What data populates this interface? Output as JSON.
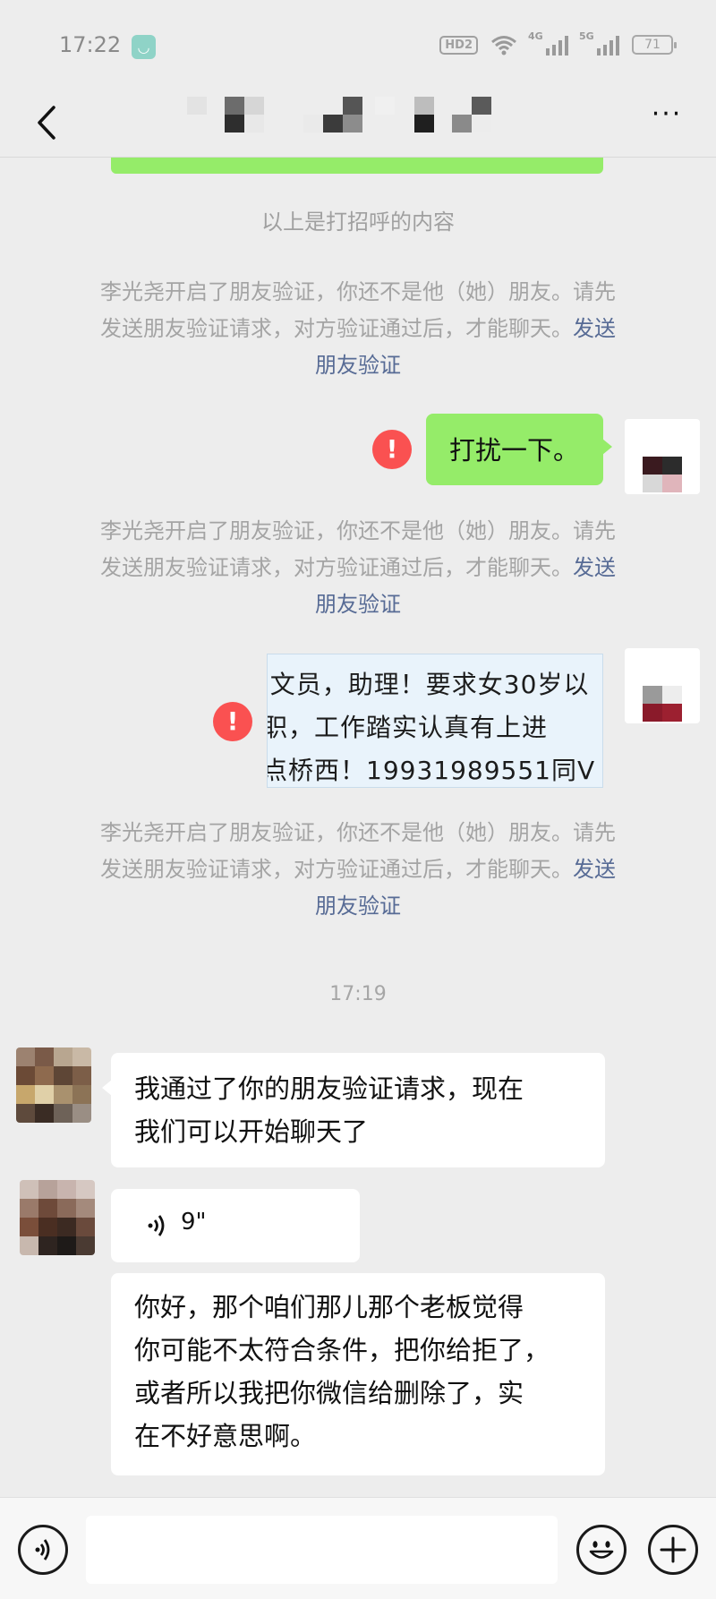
{
  "status_bar": {
    "time": "17:22",
    "hd_label": "HD2",
    "sig1_label": "4G",
    "sig2_label": "5G",
    "battery": "71"
  },
  "header": {
    "back_icon": "chevron-left-icon",
    "title_pixelated": true,
    "more_icon": "more-dots-icon"
  },
  "greeting_note": "以上是打招呼的内容",
  "system_notices": [
    {
      "line1": "李光尧开启了朋友验证，你还不是他（她）朋友。请先",
      "line2": "发送朋友验证请求，对方验证通过后，才能聊天。",
      "link_tail": "发送",
      "link_line3": "朋友验证"
    },
    {
      "line1": "李光尧开启了朋友验证，你还不是他（她）朋友。请先",
      "line2": "发送朋友验证请求，对方验证通过后，才能聊天。",
      "link_tail": "发送",
      "link_line3": "朋友验证"
    },
    {
      "line1": "李光尧开启了朋友验证，你还不是他（她）朋友。请先",
      "line2": "发送朋友验证请求，对方验证通过后，才能聊天。",
      "link_tail": "发送",
      "link_line3": "朋友验证"
    }
  ],
  "messages": {
    "sent_text": "打扰一下。",
    "sent_image_lines": [
      "i文员，助理！要求女30岁以",
      "职，工作踏实认真有上进",
      "点桥西！19931989551同V"
    ],
    "error_mark": "!",
    "timestamp": "17:19",
    "recv_1": {
      "line1": "我通过了你的朋友验证请求，现在",
      "line2": "我们可以开始聊天了"
    },
    "voice_duration": "9\"",
    "recv_2": {
      "line1": "你好，那个咱们那儿那个老板觉得",
      "line2": "你可能不太符合条件，把你给拒了，",
      "line3": "或者所以我把你微信给删除了，实",
      "line4": "在不好意思啊。"
    }
  },
  "bottom_bar": {
    "voice_icon": "voice-input-icon",
    "emoji_icon": "emoji-icon",
    "plus_icon": "plus-icon",
    "input_value": ""
  },
  "colors": {
    "background": "#ededed",
    "sent_bubble": "#95ec69",
    "error_red": "#fa5151",
    "link_blue": "#576b95",
    "system_text": "#a4a4a4"
  }
}
